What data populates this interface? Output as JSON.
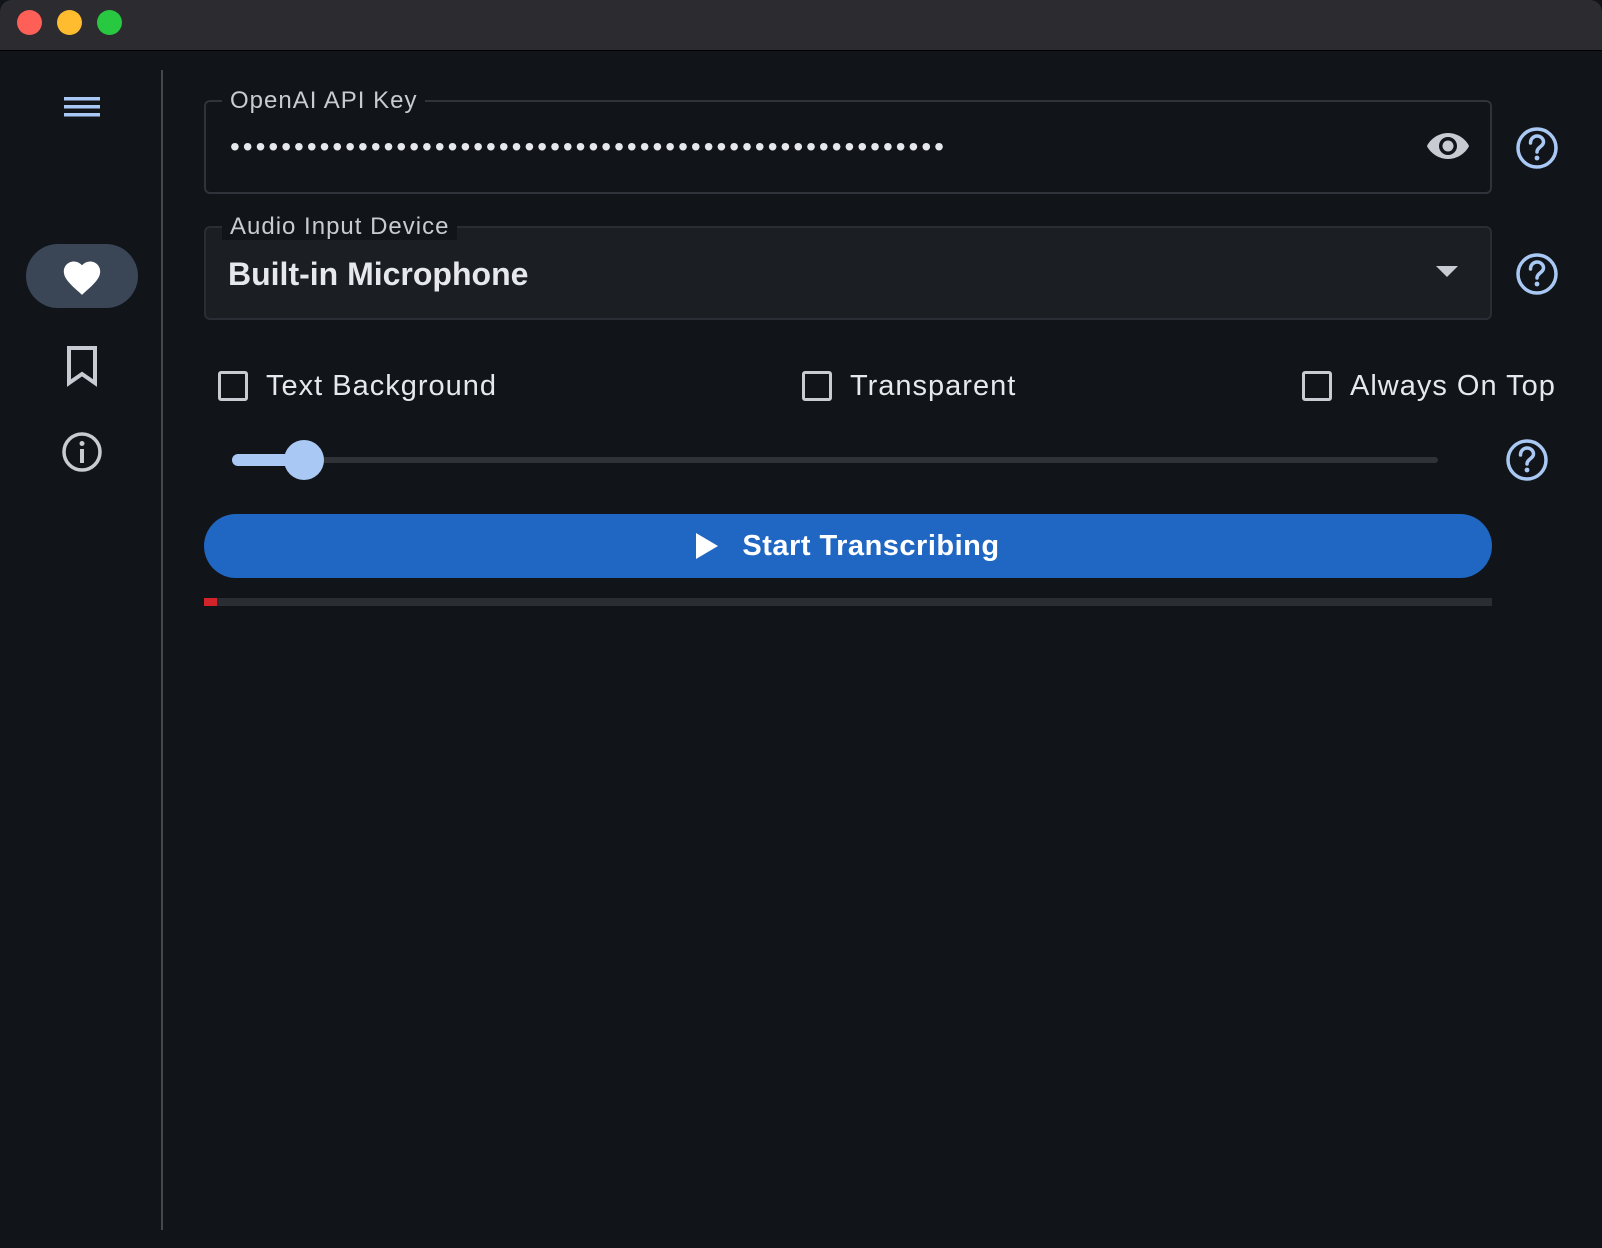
{
  "window": {
    "traffic_lights": {
      "close_color": "#fe5f57",
      "minimize_color": "#febc2e",
      "zoom_color": "#28c840"
    }
  },
  "rail": {
    "items": [
      {
        "name": "menu",
        "icon": "menu-icon",
        "selected": false
      },
      {
        "name": "favorites",
        "icon": "heart-icon",
        "selected": true
      },
      {
        "name": "bookmarks",
        "icon": "bookmark-icon",
        "selected": false
      },
      {
        "name": "info",
        "icon": "info-icon",
        "selected": false
      }
    ]
  },
  "api_key": {
    "label": "OpenAI API Key",
    "masked_value": "••••••••••••••••••••••••••••••••••••••••••••••••••••••••",
    "visibility_icon": "eye-icon",
    "help_icon": "help-icon"
  },
  "audio_device": {
    "label": "Audio Input Device",
    "selected": "Built-in Microphone",
    "help_icon": "help-icon"
  },
  "options": {
    "text_background": {
      "label": "Text Background",
      "checked": false
    },
    "transparent": {
      "label": "Transparent",
      "checked": false
    },
    "always_on_top": {
      "label": "Always On Top",
      "checked": false
    }
  },
  "slider": {
    "value_fraction": 0.06,
    "help_icon": "help-icon"
  },
  "start_button": {
    "label": "Start Transcribing",
    "icon": "play-icon"
  },
  "progress": {
    "value_fraction": 0.01
  },
  "colors": {
    "accent": "#a9c9f4",
    "primary_button": "#1f67c2",
    "progress_fill": "#d0232a",
    "background": "#111418"
  }
}
